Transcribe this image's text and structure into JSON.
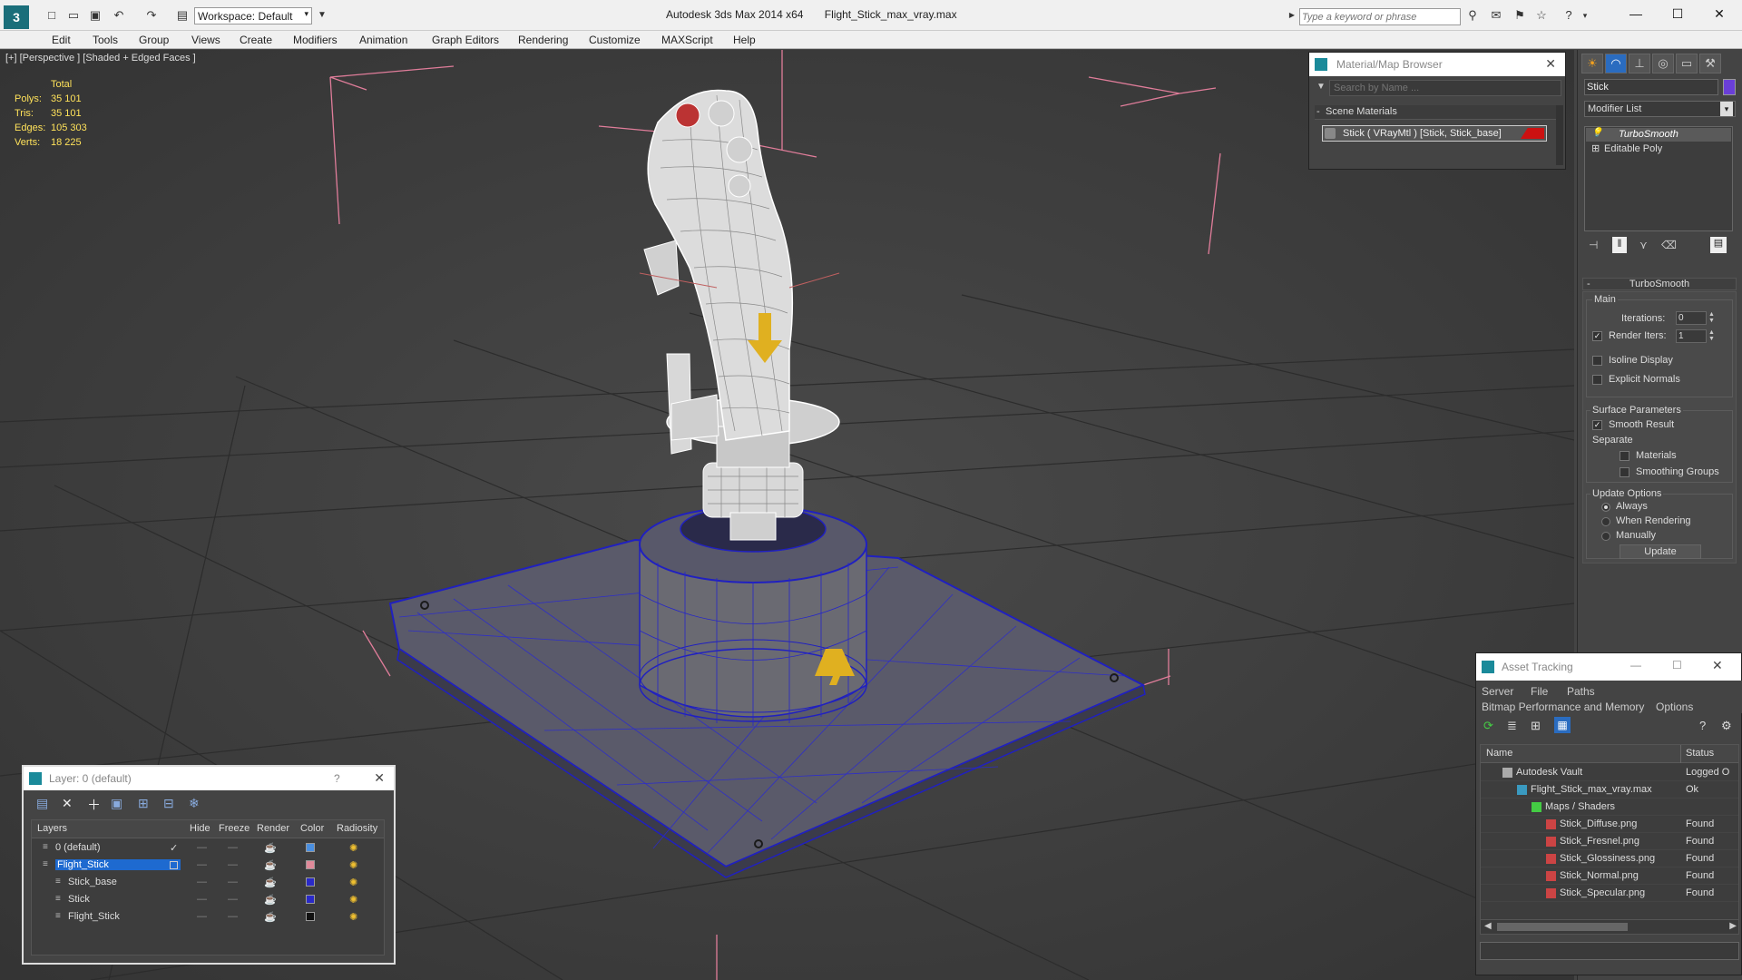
{
  "app": {
    "title": "Autodesk 3ds Max  2014 x64",
    "file": "Flight_Stick_max_vray.max",
    "workspace": "Workspace: Default",
    "search_placeholder": "Type a keyword or phrase"
  },
  "menu": [
    "Edit",
    "Tools",
    "Group",
    "Views",
    "Create",
    "Modifiers",
    "Animation",
    "Graph Editors",
    "Rendering",
    "Customize",
    "MAXScript",
    "Help"
  ],
  "viewport": {
    "label": "[+] [Perspective ] [Shaded + Edged Faces ]",
    "stats": {
      "header": "Total",
      "polys_label": "Polys:",
      "polys": "35 101",
      "tris_label": "Tris:",
      "tris": "35 101",
      "edges_label": "Edges:",
      "edges": "105 303",
      "verts_label": "Verts:",
      "verts": "18 225"
    }
  },
  "material_browser": {
    "title": "Material/Map Browser",
    "search_placeholder": "Search by Name ...",
    "section": "Scene Materials",
    "item": "Stick  ( VRayMtl )  [Stick, Stick_base]",
    "item_color": "#cc1111"
  },
  "command_panel": {
    "object_name": "Stick",
    "object_color": "#6a3fd8",
    "modifier_list": "Modifier List",
    "stack": [
      "TurboSmooth",
      "Editable Poly"
    ],
    "turbosmooth": {
      "title": "TurboSmooth",
      "main_label": "Main",
      "iterations_label": "Iterations:",
      "iterations": "0",
      "render_iters_label": "Render Iters:",
      "render_iters": "1",
      "isoline": "Isoline Display",
      "explicit": "Explicit Normals",
      "surface_label": "Surface Parameters",
      "smooth_result": "Smooth Result",
      "separate_label": "Separate",
      "materials": "Materials",
      "smoothing_groups": "Smoothing Groups",
      "update_options": "Update Options",
      "always": "Always",
      "when_rendering": "When Rendering",
      "manually": "Manually",
      "update_btn": "Update"
    }
  },
  "layer_dialog": {
    "title": "Layer: 0 (default)",
    "help": "?",
    "columns": [
      "Layers",
      "Hide",
      "Freeze",
      "Render",
      "Color",
      "Radiosity"
    ],
    "rows": [
      {
        "name": "0 (default)",
        "color": "#4a8fe0",
        "indent": 0
      },
      {
        "name": "Flight_Stick",
        "color": "#e08a9a",
        "indent": 0
      },
      {
        "name": "Stick_base",
        "color": "#2a2ac8",
        "indent": 1
      },
      {
        "name": "Stick",
        "color": "#2a2ac8",
        "indent": 1
      },
      {
        "name": "Flight_Stick",
        "color": "#111111",
        "indent": 1
      }
    ]
  },
  "asset_tracking": {
    "title": "Asset Tracking",
    "menu": [
      "Server",
      "File",
      "Paths"
    ],
    "menu2": [
      "Bitmap Performance and Memory",
      "Options"
    ],
    "columns": [
      "Name",
      "Status"
    ],
    "rows": [
      {
        "name": "Autodesk Vault",
        "status": "Logged O",
        "indent": 0,
        "icon": "vault-icon"
      },
      {
        "name": "Flight_Stick_max_vray.max",
        "status": "Ok",
        "indent": 1,
        "icon": "max-file-icon"
      },
      {
        "name": "Maps / Shaders",
        "status": "",
        "indent": 2,
        "icon": "maps-icon"
      },
      {
        "name": "Stick_Diffuse.png",
        "status": "Found",
        "indent": 3,
        "icon": "png-icon"
      },
      {
        "name": "Stick_Fresnel.png",
        "status": "Found",
        "indent": 3,
        "icon": "png-icon"
      },
      {
        "name": "Stick_Glossiness.png",
        "status": "Found",
        "indent": 3,
        "icon": "png-icon"
      },
      {
        "name": "Stick_Normal.png",
        "status": "Found",
        "indent": 3,
        "icon": "png-icon"
      },
      {
        "name": "Stick_Specular.png",
        "status": "Found",
        "indent": 3,
        "icon": "png-icon"
      }
    ]
  }
}
